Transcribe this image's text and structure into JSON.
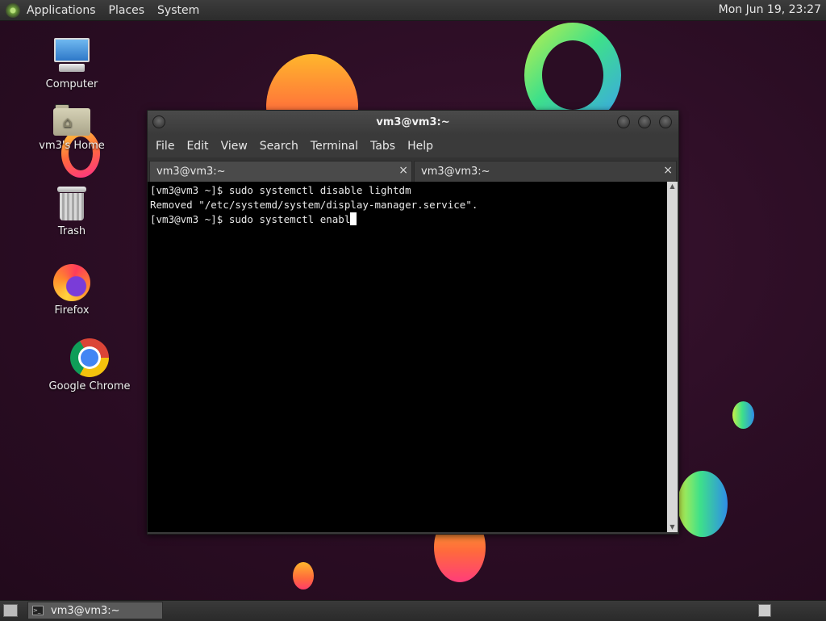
{
  "top_panel": {
    "menus": [
      "Applications",
      "Places",
      "System"
    ],
    "clock": "Mon Jun 19, 23:27"
  },
  "desktop_icons": [
    {
      "label": "Computer",
      "icon": "computer-icon"
    },
    {
      "label": "vm3's Home",
      "icon": "home-folder-icon"
    },
    {
      "label": "Trash",
      "icon": "trash-icon"
    },
    {
      "label": "Firefox",
      "icon": "firefox-icon"
    },
    {
      "label": "Google Chrome",
      "icon": "chrome-icon"
    }
  ],
  "terminal": {
    "title": "vm3@vm3:~",
    "menu": [
      "File",
      "Edit",
      "View",
      "Search",
      "Terminal",
      "Tabs",
      "Help"
    ],
    "tabs": [
      {
        "label": "vm3@vm3:~",
        "close": "×",
        "active": false
      },
      {
        "label": "vm3@vm3:~",
        "close": "×",
        "active": true
      }
    ],
    "lines": [
      "[vm3@vm3 ~]$ sudo systemctl disable lightdm",
      "Removed \"/etc/systemd/system/display-manager.service\".",
      "[vm3@vm3 ~]$ sudo systemctl enabl"
    ]
  },
  "taskbar": {
    "task_label": "vm3@vm3:~"
  },
  "colors": {
    "desktop_bg": "#2b0d24",
    "panel_bg": "#2c2c2c",
    "terminal_bg": "#000000"
  }
}
